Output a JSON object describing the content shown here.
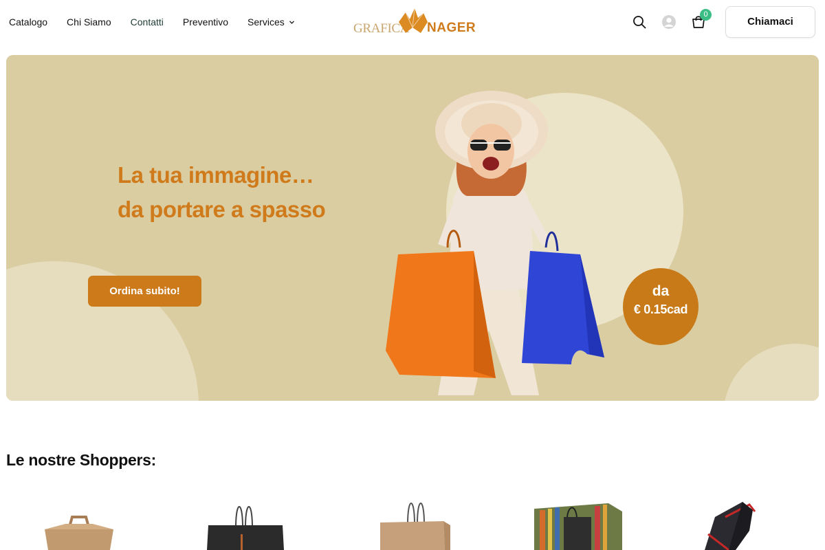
{
  "header": {
    "nav": [
      {
        "label": "Catalogo"
      },
      {
        "label": "Chi Siamo"
      },
      {
        "label": "Contatti"
      },
      {
        "label": "Preventivo"
      },
      {
        "label": "Services"
      }
    ],
    "logo": {
      "text_left": "GRAFICA",
      "text_right": "NAGER",
      "color": "#d07b1b"
    },
    "icons": [
      "search-icon",
      "user-icon",
      "cart-icon"
    ],
    "cart_count": "0",
    "call_button": "Chiamaci"
  },
  "hero": {
    "title_line1": "La tua immagine…",
    "title_line2": "da portare a spasso",
    "cta": "Ordina subito!",
    "price_prefix": "da",
    "price_value": "€ 0.15cad",
    "bg_color": "#dbcda2",
    "accent_color": "#cc7a1a"
  },
  "products": {
    "title": "Le nostre Shoppers:"
  }
}
